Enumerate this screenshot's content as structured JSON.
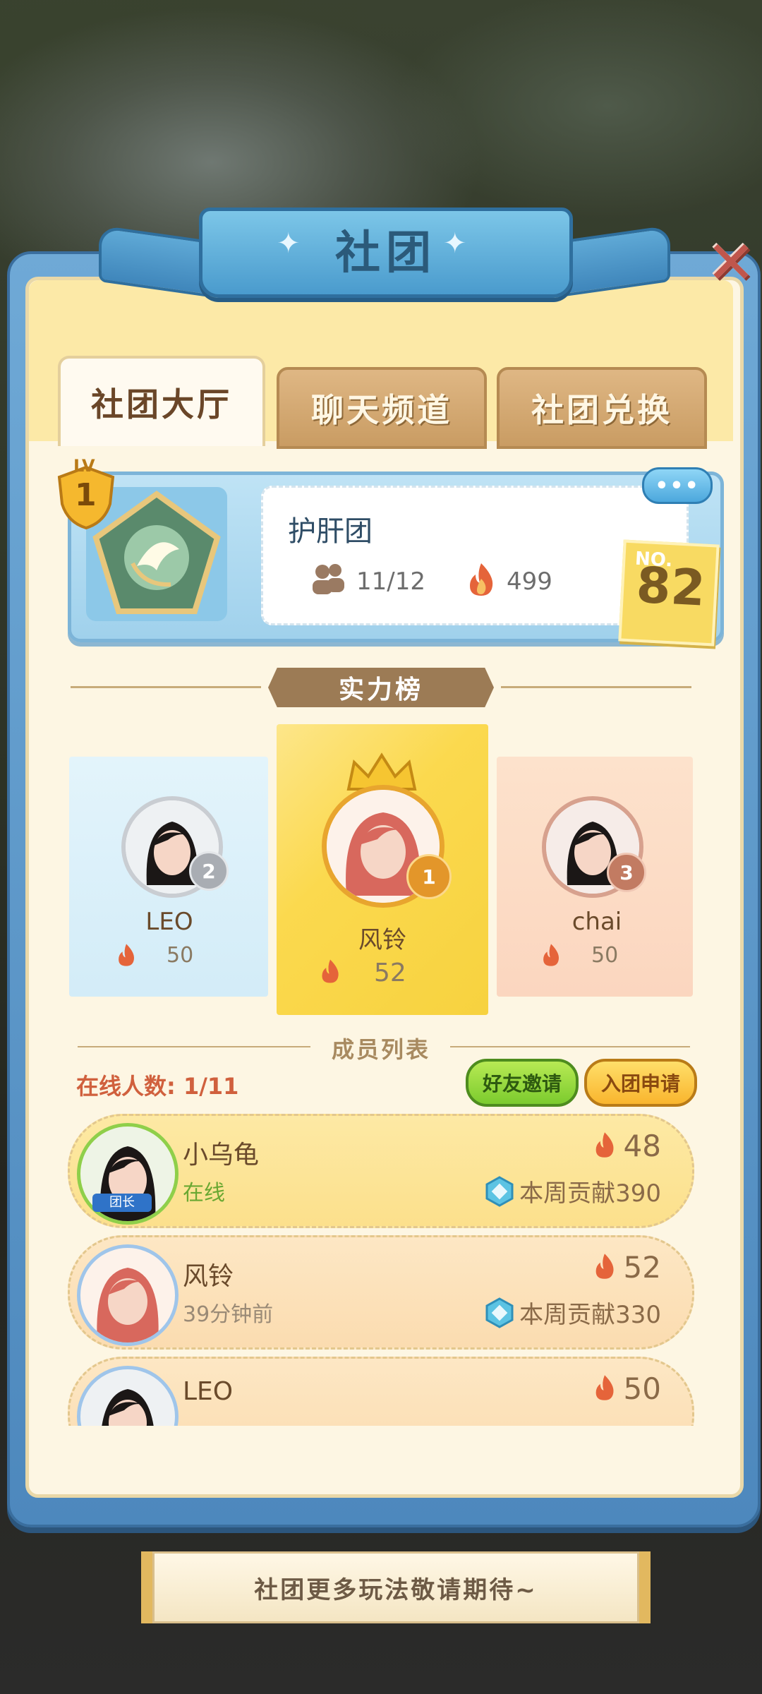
{
  "header": {
    "title": "社团"
  },
  "tabs": [
    {
      "label": "社团大厅",
      "active": true
    },
    {
      "label": "聊天频道",
      "active": false
    },
    {
      "label": "社团兑换",
      "active": false
    }
  ],
  "club": {
    "level_prefix": "LV",
    "level": "1",
    "name": "护肝团",
    "members": "11/12",
    "power": "499",
    "more_label": "•••",
    "rank_prefix": "NO.",
    "rank": "82"
  },
  "ranking": {
    "title": "实力榜",
    "podium": [
      {
        "rank": "2",
        "name": "LEO",
        "power": "50"
      },
      {
        "rank": "1",
        "name": "风铃",
        "power": "52"
      },
      {
        "rank": "3",
        "name": "chai",
        "power": "50"
      }
    ]
  },
  "member_list": {
    "title": "成员列表",
    "online": "在线人数: 1/11",
    "invite_label": "好友邀请",
    "apply_label": "入团申请",
    "rows": [
      {
        "name": "小乌龟",
        "status": "在线",
        "power": "48",
        "contribution": "本周贡献390",
        "leader_tag": "团长"
      },
      {
        "name": "风铃",
        "status": "39分钟前",
        "power": "52",
        "contribution": "本周贡献330"
      },
      {
        "name": "LEO",
        "status": "",
        "power": "50",
        "contribution": ""
      }
    ]
  },
  "footer": {
    "text": "社团更多玩法敬请期待~"
  },
  "colors": {
    "accent_blue": "#4a9bcd",
    "gold": "#f7d23f",
    "online_green": "#6aa832",
    "fire": "#e5643a"
  }
}
